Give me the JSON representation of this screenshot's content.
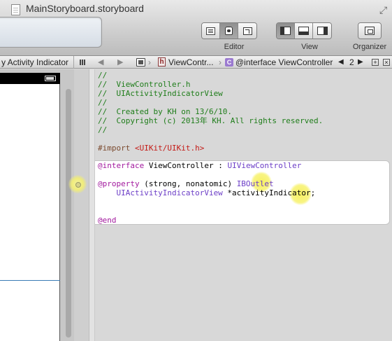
{
  "window": {
    "title": "MainStoryboard.storyboard"
  },
  "toolbar": {
    "editor_label": "Editor",
    "view_label": "View",
    "organizer_label": "Organizer",
    "editor_modes": [
      "standard-editor",
      "assistant-editor",
      "version-editor"
    ],
    "selected_editor_mode": "assistant-editor",
    "view_toggles": [
      "navigator",
      "debug-area",
      "utilities"
    ],
    "active_view_toggles": [
      "navigator"
    ]
  },
  "jump_bar": {
    "left_label": "y Activity Indicator",
    "file": "ViewContr...",
    "symbol": "@interface ViewController",
    "symbol_icon": "C",
    "header_icon": "h",
    "count": "2",
    "add": "+",
    "close": "×"
  },
  "code": {
    "lines": [
      "//",
      "//  ViewController.h",
      "//  UIActivityIndicatorView",
      "//",
      "//  Created by KH on 13/6/10.",
      "//  Copyright (c) 2013年 KH. All rights reserved.",
      "//"
    ],
    "import_directive": "#import",
    "import_file": "<UIKit/UIKit.h>",
    "interface_kw": "@interface",
    "interface_rest": " ViewController : ",
    "superclass": "UIViewController",
    "property_kw": "@property",
    "property_attrs": " (strong, nonatomic) ",
    "iboutlet": "IBOutlet",
    "property_type": "    UIActivityIndicatorView",
    "property_name": " *activityIndicator;",
    "end_kw": "@end"
  },
  "colors": {
    "comment": "#1f7d1a",
    "keyword": "#a21a9e",
    "string": "#c41a16",
    "class": "#6c3ec7",
    "highlight": "#f6f05a"
  }
}
